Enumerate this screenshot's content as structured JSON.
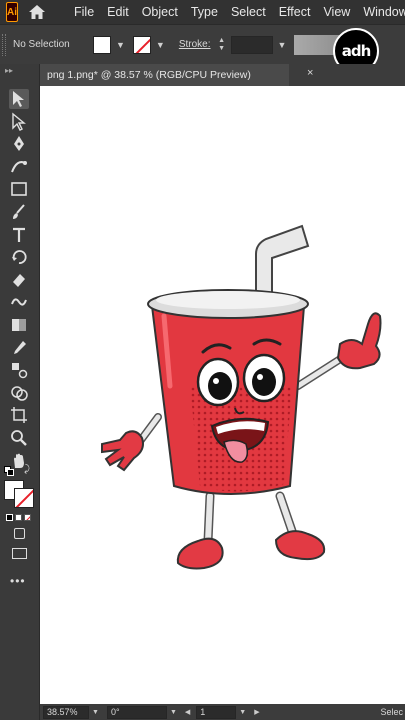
{
  "app": {
    "logo_text": "Ai",
    "menu": [
      "File",
      "Edit",
      "Object",
      "Type",
      "Select",
      "Effect",
      "View",
      "Window"
    ]
  },
  "control_bar": {
    "selection_label": "No Selection",
    "stroke_label": "Stroke:",
    "stroke_value": "",
    "overlay_badge": "adh"
  },
  "document": {
    "tab_title": "png 1.png* @ 38.57 % (RGB/CPU Preview)",
    "close_glyph": "×"
  },
  "status_bar": {
    "zoom": "38.57%",
    "rotation": "0°",
    "artboard": "1",
    "tool_hint": "Selec"
  },
  "colors": {
    "accent_red": "#e8202a",
    "ui_dark": "#323232",
    "canvas": "#ffffff",
    "cup_red": "#e23840"
  },
  "tools": [
    "selection-tool",
    "direct-selection-tool",
    "pen-tool",
    "curvature-tool",
    "rectangle-tool",
    "paintbrush-tool",
    "type-tool",
    "rotate-tool",
    "eraser-tool",
    "warp-tool",
    "gradient-tool",
    "eyedropper-tool",
    "blend-tool",
    "shape-builder-tool",
    "artboard-tool",
    "zoom-tool",
    "hand-tool"
  ]
}
